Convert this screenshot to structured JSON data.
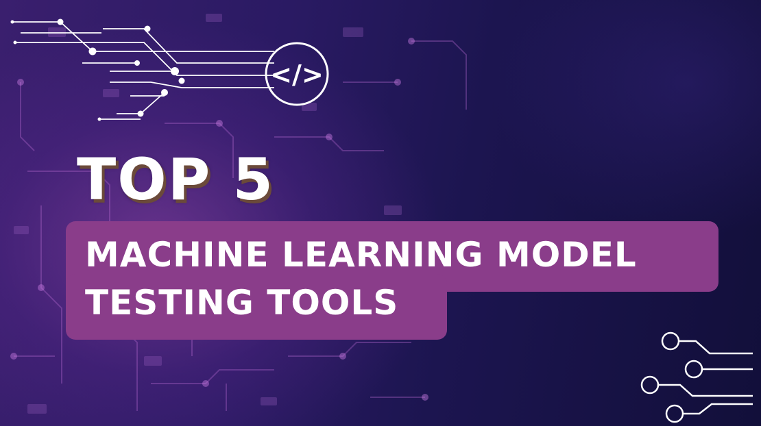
{
  "banner": {
    "headline": "TOP 5",
    "subtitle_line_1": "MACHINE LEARNING MODEL",
    "subtitle_line_2": "TESTING TOOLS"
  },
  "colors": {
    "background_dark": "#1a1240",
    "background_purple": "#3a1f6e",
    "accent_box": "#8a3d8a",
    "headline_shadow": "#6b4a3a",
    "text": "#ffffff"
  },
  "icons": {
    "code": "code-brackets-icon",
    "circuit": "circuit-lines-icon",
    "nodes": "circuit-nodes-icon"
  }
}
